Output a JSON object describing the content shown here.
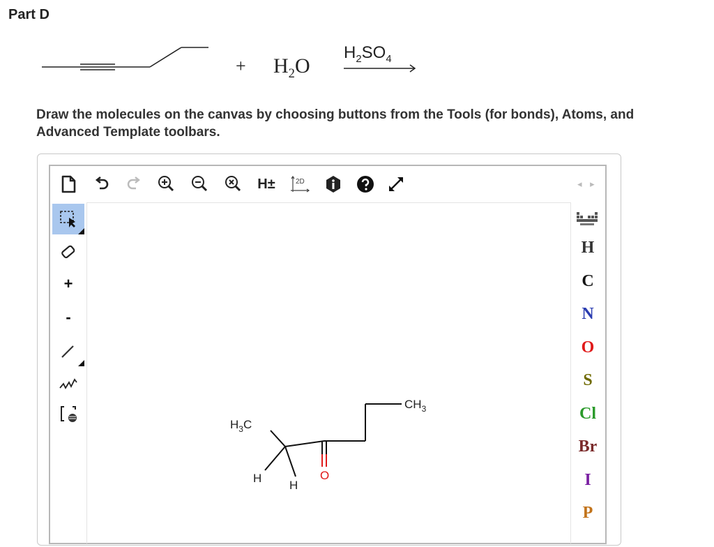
{
  "part_title": "Part D",
  "reaction": {
    "plus": "+",
    "reagent_main": "H",
    "reagent_sub": "2",
    "reagent_tail": "O",
    "catalyst_main": "H",
    "catalyst_sub1": "2",
    "catalyst_mid": "SO",
    "catalyst_sub2": "4"
  },
  "instructions": "Draw the molecules on the canvas by choosing buttons from the Tools (for bonds), Atoms, and Advanced Template toolbars.",
  "top_toolbar": {
    "items": [
      "new-document",
      "undo",
      "redo",
      "zoom-in",
      "zoom-out",
      "zoom-reset",
      "h-toggle",
      "2d-clean",
      "info",
      "help",
      "fullscreen"
    ],
    "h_label": "H±",
    "clean_label": "2D"
  },
  "left_toolbar": {
    "items": [
      "select",
      "erase",
      "charge-plus",
      "charge-minus",
      "single-bond",
      "chain",
      "template"
    ],
    "selected": "select",
    "charge_plus": "+",
    "charge_minus": "-"
  },
  "right_toolbar": {
    "nav": "◂ ▸",
    "atoms": [
      {
        "symbol": "H",
        "color": "#333333"
      },
      {
        "symbol": "C",
        "color": "#111111"
      },
      {
        "symbol": "N",
        "color": "#2b3db1"
      },
      {
        "symbol": "O",
        "color": "#e01a1a"
      },
      {
        "symbol": "S",
        "color": "#6f6a00"
      },
      {
        "symbol": "Cl",
        "color": "#2a9a2a"
      },
      {
        "symbol": "Br",
        "color": "#7a2a2a"
      },
      {
        "symbol": "I",
        "color": "#7a1fa2"
      },
      {
        "symbol": "P",
        "color": "#c2731a"
      }
    ]
  },
  "canvas_molecule": {
    "labels": {
      "ch3_right_main": "CH",
      "ch3_right_sub": "3",
      "h3c_left_main": "H",
      "h3c_left_sub": "3",
      "h3c_left_tail": "C",
      "h_left": "H",
      "h_right": "H",
      "oxygen": "O"
    },
    "oxygen_color": "#e01a1a"
  }
}
